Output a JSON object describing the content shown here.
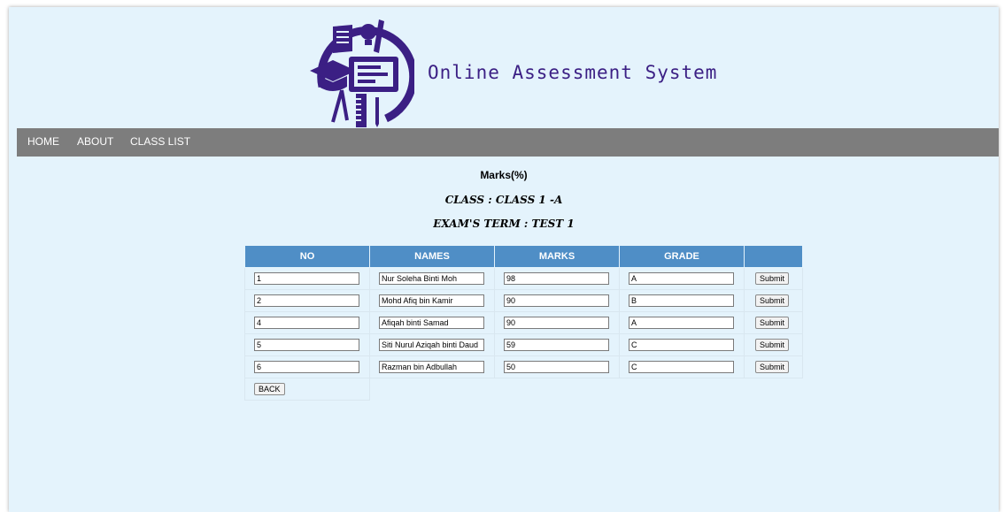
{
  "header": {
    "brand_title": "Online Assessment System"
  },
  "nav": {
    "items": [
      {
        "label": "HOME"
      },
      {
        "label": "ABOUT"
      },
      {
        "label": "CLASS LIST"
      }
    ]
  },
  "headings": {
    "marks": "Marks(%)",
    "class": "CLASS : CLASS 1 -A",
    "term": "EXAM'S TERM : TEST 1"
  },
  "table": {
    "columns": [
      "NO",
      "NAMES",
      "MARKS",
      "GRADE",
      ""
    ],
    "rows": [
      {
        "no": "1",
        "name": "Nur Soleha Binti Moh",
        "marks": "98",
        "grade": "A"
      },
      {
        "no": "2",
        "name": "Mohd Afiq bin Kamir",
        "marks": "90",
        "grade": "B"
      },
      {
        "no": "4",
        "name": "Afiqah binti Samad",
        "marks": "90",
        "grade": "A"
      },
      {
        "no": "5",
        "name": "Siti Nurul Aziqah binti Daud",
        "marks": "59",
        "grade": "C"
      },
      {
        "no": "6",
        "name": "Razman bin Adbullah",
        "marks": "50",
        "grade": "C"
      }
    ],
    "submit_label": "Submit",
    "back_label": "BACK"
  },
  "colors": {
    "page_bg": "#e4f3fc",
    "nav_bg": "#7d7d7d",
    "table_header_bg": "#4f8ec6",
    "brand_purple": "#3b1f84"
  }
}
